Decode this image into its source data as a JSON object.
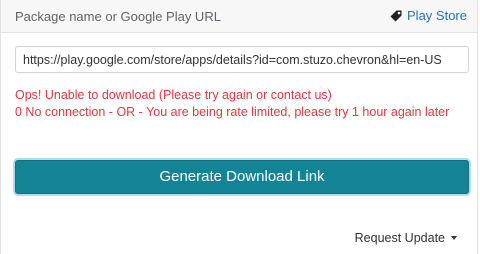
{
  "header": {
    "title": "Package name or Google Play URL",
    "playstore_label": "Play Store",
    "playstore_icon": "tag-icon"
  },
  "form": {
    "url_value": "https://play.google.com/store/apps/details?id=com.stuzo.chevron&hl=en-US",
    "error_line_1": "Ops! Unable to download (Please try again or contact us)",
    "error_line_2": "0 No connection - OR - You are being rate limited, please try 1 hour again later",
    "generate_label": "Generate Download Link"
  },
  "footer": {
    "request_update_label": "Request Update"
  },
  "colors": {
    "accent": "#138496",
    "error": "#e0383e",
    "link": "#2a6fb6"
  }
}
